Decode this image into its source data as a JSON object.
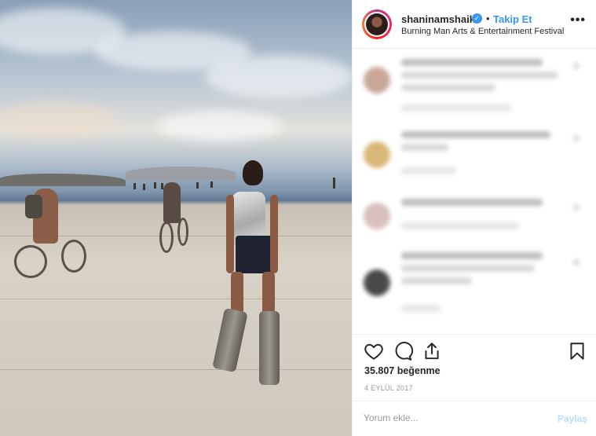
{
  "post": {
    "username": "shaninamshaik",
    "verified_icon": "verified-badge-icon",
    "separator": "•",
    "follow_label": "Takip Et",
    "location": "Burning Man Arts & Entertainment Festival",
    "more_label": "•••",
    "likes": "35.807 beğenme",
    "date": "4 EYLÜL 2017"
  },
  "actions": {
    "like_icon": "heart-icon",
    "comment_icon": "comment-icon",
    "share_icon": "share-icon",
    "save_icon": "bookmark-icon"
  },
  "add_comment": {
    "placeholder": "Yorum ekle...",
    "post_label": "Paylaş"
  },
  "colors": {
    "accent": "#3897f0",
    "post_disabled": "#b2dffc"
  }
}
